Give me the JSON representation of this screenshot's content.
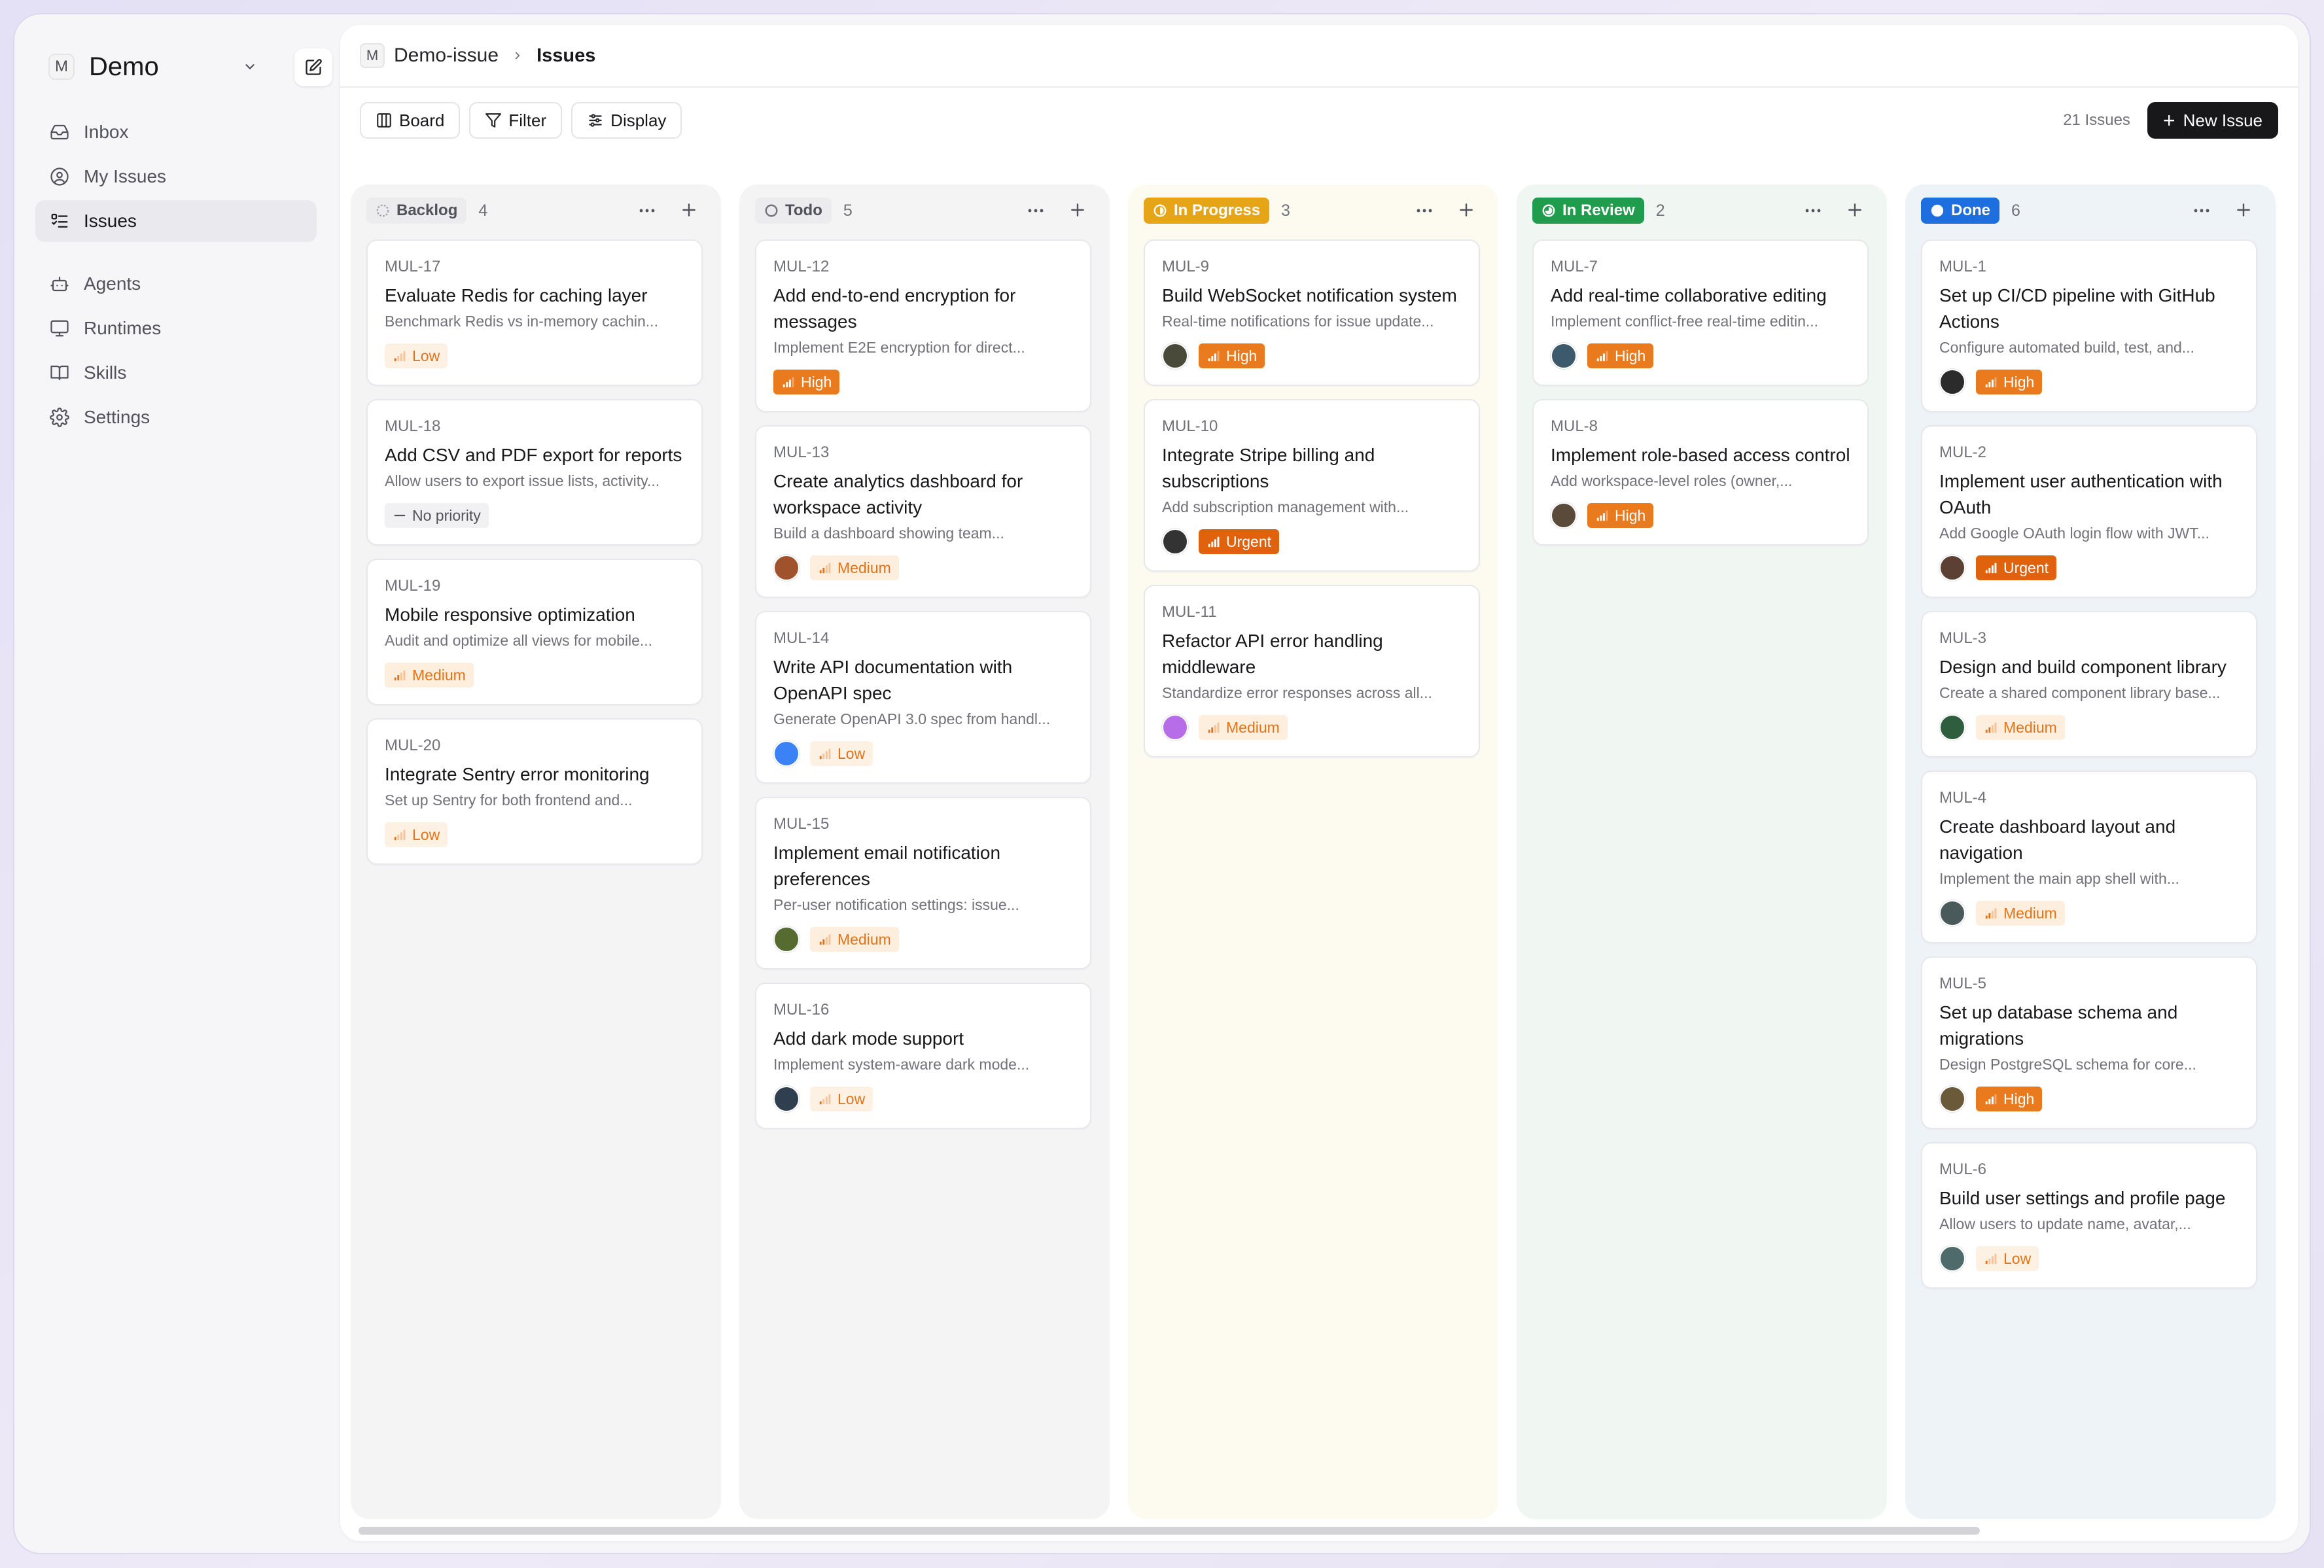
{
  "workspace": {
    "logo_letter": "M",
    "name": "Demo"
  },
  "nav": {
    "primary": [
      {
        "label": "Inbox",
        "icon": "inbox-icon"
      },
      {
        "label": "My Issues",
        "icon": "user-circle-icon"
      },
      {
        "label": "Issues",
        "icon": "list-icon",
        "active": true
      }
    ],
    "secondary": [
      {
        "label": "Agents",
        "icon": "bot-icon"
      },
      {
        "label": "Runtimes",
        "icon": "monitor-icon"
      },
      {
        "label": "Skills",
        "icon": "book-icon"
      },
      {
        "label": "Settings",
        "icon": "gear-icon"
      }
    ]
  },
  "breadcrumb": {
    "logo_letter": "M",
    "project": "Demo-issue",
    "page": "Issues"
  },
  "toolbar": {
    "board_label": "Board",
    "filter_label": "Filter",
    "display_label": "Display",
    "issue_count": "21 Issues",
    "new_issue_label": "New Issue"
  },
  "columns": [
    {
      "name": "Backlog",
      "count": "4",
      "status": "backlog",
      "bg": "#f4f4f5",
      "badge_bg": "#ececef",
      "badge_fg": "#52525b",
      "cards": [
        {
          "id": "MUL-17",
          "title": "Evaluate Redis for caching layer",
          "desc": "Benchmark Redis vs in-memory cachin...",
          "priority": "Low",
          "avatar": null
        },
        {
          "id": "MUL-18",
          "title": "Add CSV and PDF export for reports",
          "desc": "Allow users to export issue lists, activity...",
          "priority": "No priority",
          "avatar": null
        },
        {
          "id": "MUL-19",
          "title": "Mobile responsive optimization",
          "desc": "Audit and optimize all views for mobile...",
          "priority": "Medium",
          "avatar": null
        },
        {
          "id": "MUL-20",
          "title": "Integrate Sentry error monitoring",
          "desc": "Set up Sentry for both frontend and...",
          "priority": "Low",
          "avatar": null
        }
      ]
    },
    {
      "name": "Todo",
      "count": "5",
      "status": "todo",
      "bg": "#f4f4f5",
      "badge_bg": "#ececef",
      "badge_fg": "#52525b",
      "cards": [
        {
          "id": "MUL-12",
          "title": "Add end-to-end encryption for messages",
          "desc": "Implement E2E encryption for direct...",
          "priority": "High",
          "avatar": null
        },
        {
          "id": "MUL-13",
          "title": "Create analytics dashboard for workspace activity",
          "desc": "Build a dashboard showing team...",
          "priority": "Medium",
          "avatar": "#a0522d"
        },
        {
          "id": "MUL-14",
          "title": "Write API documentation with OpenAPI spec",
          "desc": "Generate OpenAPI 3.0 spec from handl...",
          "priority": "Low",
          "avatar": "#3b82f6"
        },
        {
          "id": "MUL-15",
          "title": "Implement email notification preferences",
          "desc": "Per-user notification settings: issue...",
          "priority": "Medium",
          "avatar": "#556b2f"
        },
        {
          "id": "MUL-16",
          "title": "Add dark mode support",
          "desc": "Implement system-aware dark mode...",
          "priority": "Low",
          "avatar": "#2f3f4f"
        }
      ]
    },
    {
      "name": "In Progress",
      "count": "3",
      "status": "in-progress",
      "bg": "#fdfaf0",
      "badge_bg": "#e6a516",
      "badge_fg": "#ffffff",
      "cards": [
        {
          "id": "MUL-9",
          "title": "Build WebSocket notification system",
          "desc": "Real-time notifications for issue update...",
          "priority": "High",
          "avatar": "#4a4a3a"
        },
        {
          "id": "MUL-10",
          "title": "Integrate Stripe billing and subscriptions",
          "desc": "Add subscription management with...",
          "priority": "Urgent",
          "avatar": "#333333"
        },
        {
          "id": "MUL-11",
          "title": "Refactor API error handling middleware",
          "desc": "Standardize error responses across all...",
          "priority": "Medium",
          "avatar": "#b76ce8"
        }
      ]
    },
    {
      "name": "In Review",
      "count": "2",
      "status": "in-review",
      "bg": "#f0f6f1",
      "badge_bg": "#1f9d4d",
      "badge_fg": "#ffffff",
      "cards": [
        {
          "id": "MUL-7",
          "title": "Add real-time collaborative editing",
          "desc": "Implement conflict-free real-time editin...",
          "priority": "High",
          "avatar": "#3d5a6c"
        },
        {
          "id": "MUL-8",
          "title": "Implement role-based access control",
          "desc": "Add workspace-level roles (owner,...",
          "priority": "High",
          "avatar": "#5a4a3a"
        }
      ]
    },
    {
      "name": "Done",
      "count": "6",
      "status": "done",
      "bg": "#eef3f8",
      "badge_bg": "#1d6fe0",
      "badge_fg": "#ffffff",
      "cards": [
        {
          "id": "MUL-1",
          "title": "Set up CI/CD pipeline with GitHub Actions",
          "desc": "Configure automated build, test, and...",
          "priority": "High",
          "avatar": "#2b2b2b"
        },
        {
          "id": "MUL-2",
          "title": "Implement user authentication with OAuth",
          "desc": "Add Google OAuth login flow with JWT...",
          "priority": "Urgent",
          "avatar": "#5c4033"
        },
        {
          "id": "MUL-3",
          "title": "Design and build component library",
          "desc": "Create a shared component library base...",
          "priority": "Medium",
          "avatar": "#2e5e3e"
        },
        {
          "id": "MUL-4",
          "title": "Create dashboard layout and navigation",
          "desc": "Implement the main app shell with...",
          "priority": "Medium",
          "avatar": "#4a5a5a"
        },
        {
          "id": "MUL-5",
          "title": "Set up database schema and migrations",
          "desc": "Design PostgreSQL schema for core...",
          "priority": "High",
          "avatar": "#6b5a3a"
        },
        {
          "id": "MUL-6",
          "title": "Build user settings and profile page",
          "desc": "Allow users to update name, avatar,...",
          "priority": "Low",
          "avatar": "#4f6a6a"
        }
      ]
    }
  ]
}
